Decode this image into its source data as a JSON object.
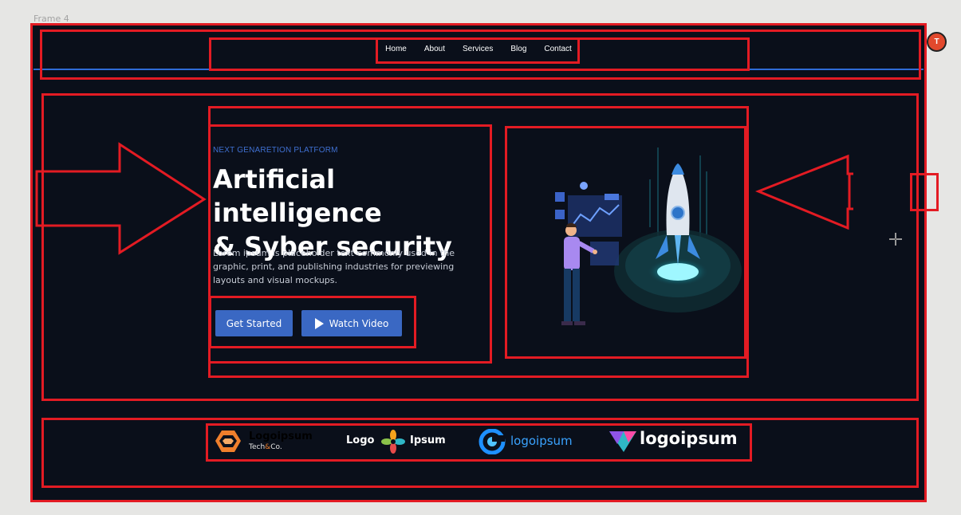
{
  "frame": {
    "label": "Frame 4"
  },
  "nav": {
    "items": [
      {
        "label": "Home"
      },
      {
        "label": "About"
      },
      {
        "label": "Services"
      },
      {
        "label": "Blog"
      },
      {
        "label": "Contact"
      }
    ]
  },
  "hero": {
    "eyebrow": "NEXT GENARETION PLATFORM",
    "headline_line1": "Artificial intelligence",
    "headline_line2": "& Syber security",
    "body": "Lorem ipsum is placeholder text commonly used in the graphic, print, and publishing industries for previewing layouts and visual mockups.",
    "primary_button": "Get Started",
    "secondary_button": "Watch Video"
  },
  "logos": [
    {
      "name": "Logoipsum",
      "sub_prefix": "Tech",
      "sub_amp": "&",
      "sub_suffix": "Co."
    },
    {
      "left": "Logo",
      "right": "Ipsum"
    },
    {
      "text": "logoipsum"
    },
    {
      "text": "logoipsum"
    }
  ],
  "user": {
    "initial": "T"
  },
  "colors": {
    "canvas": "#0a0f1a",
    "accent": "#3a68c3",
    "annotation": "#e31b23",
    "avatar": "#e2492d"
  }
}
